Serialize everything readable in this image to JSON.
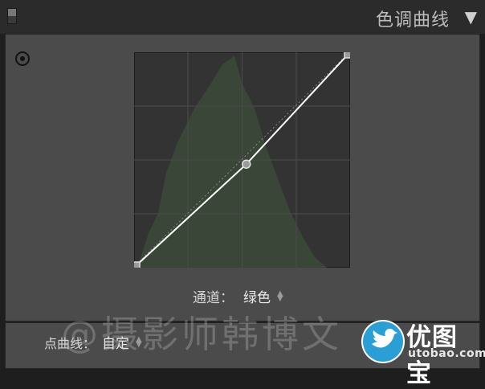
{
  "header": {
    "title": "色调曲线",
    "collapse_icon": "triangle-down-icon"
  },
  "toolbar": {
    "target_adjust_icon": "target-adjustment-icon"
  },
  "curve": {
    "channel": "绿色",
    "control_points": [
      {
        "input": 0,
        "output": 0
      },
      {
        "input": 0.52,
        "output": 0.48
      },
      {
        "input": 1,
        "output": 1
      }
    ],
    "histogram_color": "#3c4a3a",
    "curve_color": "#ffffff"
  },
  "channel": {
    "label": "通道：",
    "value": "绿色"
  },
  "point_curve": {
    "label": "点曲线：",
    "value": "自定"
  },
  "watermark": {
    "text": "@摄影师韩博文",
    "logo_cn": "优图宝",
    "logo_url": "utobao.com"
  }
}
